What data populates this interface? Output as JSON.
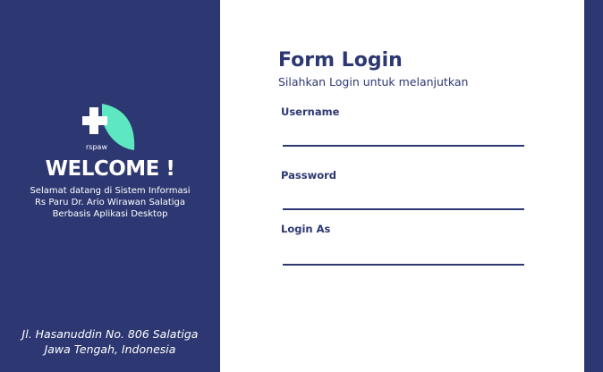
{
  "left_panel": {
    "logo_text": "rspaw",
    "welcome": "WELCOME !",
    "subtitle_lines": [
      "Selamat datang di Sistem Informasi",
      "Rs Paru Dr. Ario Wirawan Salatiga",
      "Berbasis Aplikasi Desktop"
    ],
    "address_lines": [
      "Jl. Hasanuddin No. 806 Salatiga",
      "Jawa Tengah, Indonesia"
    ]
  },
  "form": {
    "title": "Form Login",
    "subtitle": "Silahkan Login untuk melanjutkan",
    "username_label": "Username",
    "username_value": "",
    "password_label": "Password",
    "password_value": "",
    "login_as_label": "Login As",
    "login_as_value": ""
  },
  "colors": {
    "primary": "#2d3872",
    "logo_leaf": "#5ee8c1",
    "background": "#ffffff"
  },
  "icons": [
    "rspaw-logo-icon"
  ]
}
